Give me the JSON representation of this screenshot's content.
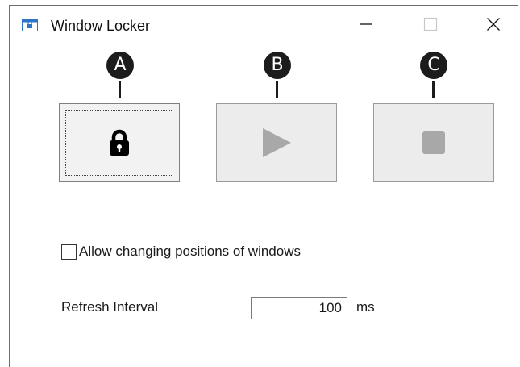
{
  "window": {
    "title": "Window Locker",
    "icons": {
      "app": "window-app-icon",
      "minimize": "minimize-icon",
      "maximize": "maximize-icon",
      "close": "close-icon"
    }
  },
  "callouts": [
    "A",
    "B",
    "C"
  ],
  "toolbar": {
    "buttons": [
      {
        "name": "lock",
        "icon": "lock-icon",
        "state": "focused"
      },
      {
        "name": "play",
        "icon": "play-icon",
        "state": "disabled"
      },
      {
        "name": "stop",
        "icon": "stop-icon",
        "state": "disabled"
      }
    ]
  },
  "options": {
    "allow_positions_label": "Allow changing positions of windows",
    "allow_positions_checked": false
  },
  "refresh": {
    "label": "Refresh Interval",
    "value": "100",
    "unit": "ms"
  },
  "colors": {
    "disabled_icon": "#a8a8a8",
    "enabled_icon": "#000000",
    "app_icon_blue": "#2e74c6"
  }
}
